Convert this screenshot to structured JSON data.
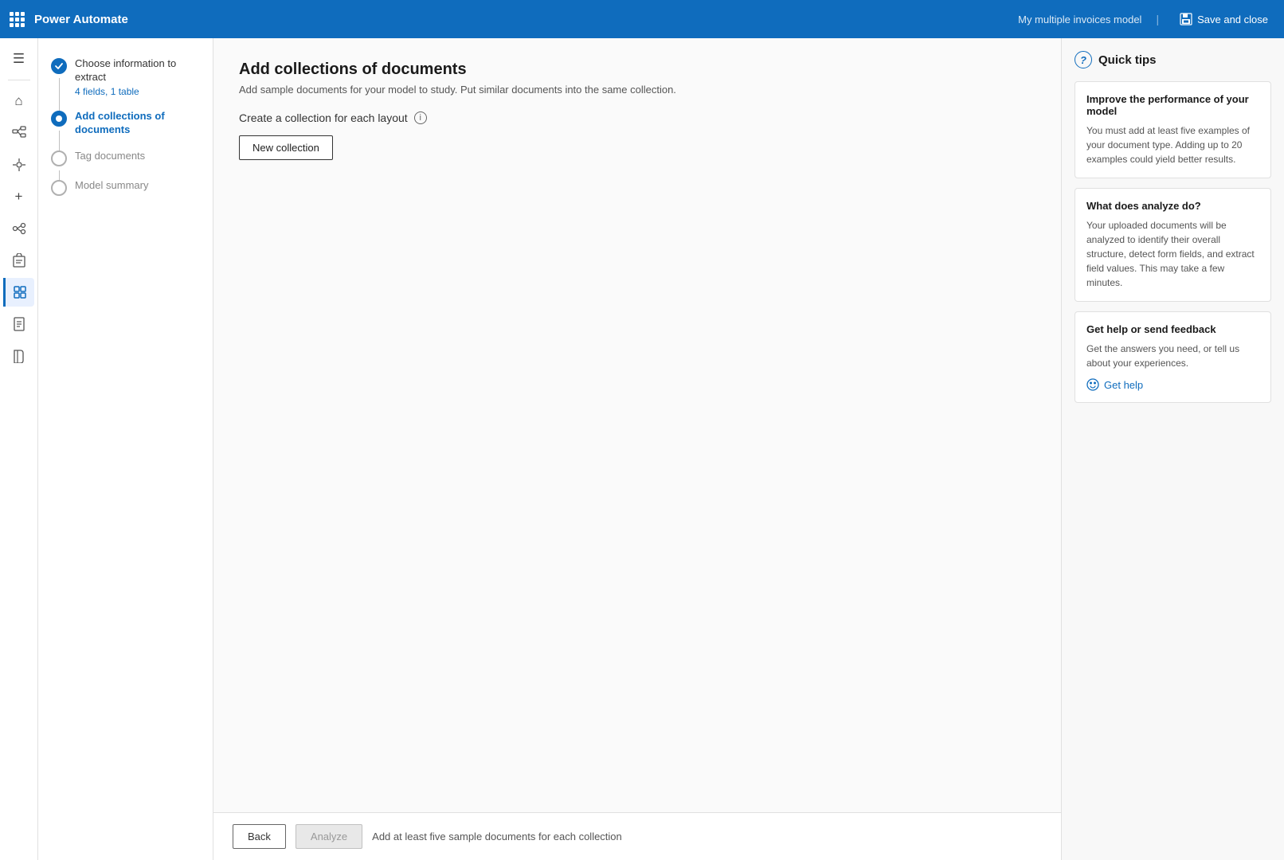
{
  "topbar": {
    "app_name": "Power Automate",
    "model_name": "My multiple invoices model",
    "save_label": "Save and close"
  },
  "steps": [
    {
      "id": "choose-info",
      "label": "Choose information to extract",
      "sub": "4 fields, 1 table",
      "state": "completed"
    },
    {
      "id": "add-collections",
      "label": "Add collections of documents",
      "sub": "",
      "state": "active"
    },
    {
      "id": "tag-documents",
      "label": "Tag documents",
      "sub": "",
      "state": "inactive"
    },
    {
      "id": "model-summary",
      "label": "Model summary",
      "sub": "",
      "state": "inactive"
    }
  ],
  "content": {
    "page_title": "Add collections of documents",
    "page_subtitle": "Add sample documents for your model to study. Put similar documents into the same collection.",
    "collection_header_label": "Create a collection for each layout",
    "new_collection_btn": "New collection"
  },
  "bottom_bar": {
    "back_label": "Back",
    "analyze_label": "Analyze",
    "hint": "Add at least five sample documents for each collection"
  },
  "quick_tips": {
    "title": "Quick tips",
    "cards": [
      {
        "title": "Improve the performance of your model",
        "body": "You must add at least five examples of your document type. Adding up to 20 examples could yield better results."
      },
      {
        "title": "What does analyze do?",
        "body": "Your uploaded documents will be analyzed to identify their overall structure, detect form fields, and extract field values. This may take a few minutes."
      },
      {
        "title": "Get help or send feedback",
        "body": "Get the answers you need, or tell us about your experiences."
      }
    ],
    "get_help_label": "Get help"
  },
  "nav_icons": [
    {
      "name": "home",
      "symbol": "⌂"
    },
    {
      "name": "apps",
      "symbol": "⊞"
    },
    {
      "name": "ai-models",
      "symbol": "✦"
    },
    {
      "name": "plus",
      "symbol": "+"
    },
    {
      "name": "connections",
      "symbol": "⚭"
    },
    {
      "name": "clipboard",
      "symbol": "📋"
    },
    {
      "name": "activity-active",
      "symbol": "⬡",
      "active": true
    },
    {
      "name": "document",
      "symbol": "📄"
    },
    {
      "name": "book",
      "symbol": "📖"
    }
  ]
}
